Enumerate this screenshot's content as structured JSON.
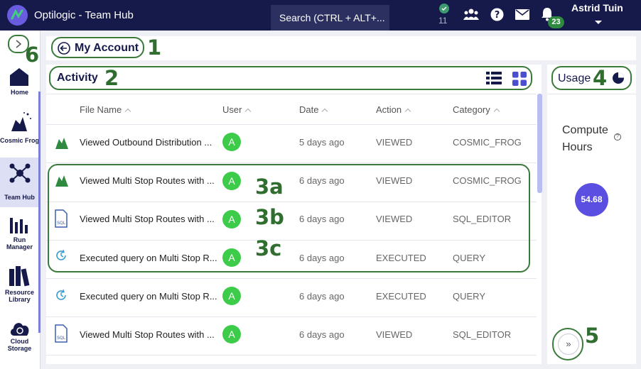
{
  "header": {
    "app_title": "Optilogic - Team Hub",
    "search_placeholder": "Search (CTRL + ALT+...",
    "status_count": "11",
    "notification_count": "23",
    "user_name": "Astrid Tuin",
    "icons": [
      "logo-icon",
      "check-icon",
      "team-icon",
      "help-icon",
      "mail-icon",
      "bell-icon"
    ]
  },
  "sidebar": {
    "items": [
      {
        "label": "Home",
        "icon": "home-icon"
      },
      {
        "label": "Cosmic Frog",
        "icon": "frog-icon"
      },
      {
        "label": "Team Hub",
        "icon": "hub-icon",
        "active": true
      },
      {
        "label": "Run Manager",
        "icon": "bars-icon"
      },
      {
        "label": "Resource Library",
        "icon": "books-icon"
      },
      {
        "label": "Cloud Storage",
        "icon": "cloud-icon"
      }
    ]
  },
  "breadcrumb": {
    "title": "My Account"
  },
  "activity": {
    "title": "Activity",
    "columns": [
      "File Name",
      "User",
      "Date",
      "Action",
      "Category"
    ],
    "rows": [
      {
        "file": "Viewed Outbound Distribution ...",
        "user": "A",
        "date": "5 days ago",
        "action": "VIEWED",
        "category": "COSMIC_FROG",
        "icon": "frog"
      },
      {
        "file": "Viewed Multi Stop Routes with ...",
        "user": "A",
        "date": "6 days ago",
        "action": "VIEWED",
        "category": "COSMIC_FROG",
        "icon": "frog"
      },
      {
        "file": "Viewed Multi Stop Routes with ...",
        "user": "A",
        "date": "6 days ago",
        "action": "VIEWED",
        "category": "SQL_EDITOR",
        "icon": "sql"
      },
      {
        "file": "Executed query on Multi Stop R...",
        "user": "A",
        "date": "6 days ago",
        "action": "EXECUTED",
        "category": "QUERY",
        "icon": "query"
      },
      {
        "file": "Executed query on Multi Stop R...",
        "user": "A",
        "date": "6 days ago",
        "action": "EXECUTED",
        "category": "QUERY",
        "icon": "query"
      },
      {
        "file": "Viewed Multi Stop Routes with ...",
        "user": "A",
        "date": "6 days ago",
        "action": "VIEWED",
        "category": "SQL_EDITOR",
        "icon": "sql"
      }
    ]
  },
  "usage": {
    "title": "Usage",
    "compute_label_1": "Compute",
    "compute_label_2": "Hours",
    "compute_value": "54.68",
    "help_glyph": "?",
    "expand_glyph": "»"
  },
  "callouts": {
    "c1": "1",
    "c2": "2",
    "c3a": "3a",
    "c3b": "3b",
    "c3c": "3c",
    "c4": "4",
    "c5": "5",
    "c6": "6"
  },
  "colors": {
    "topbar": "#161a4a",
    "accent": "#5a4fe0",
    "callout": "#2f6e2f",
    "avatar": "#3dcc4a"
  }
}
